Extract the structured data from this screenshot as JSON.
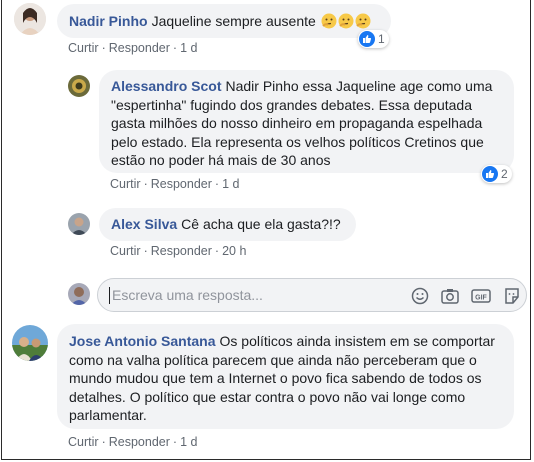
{
  "comments": [
    {
      "author": "Nadir Pinho",
      "text": "Jaqueline sempre ausente",
      "emojis": [
        "thinking-face",
        "thinking-face",
        "thinking-face"
      ],
      "actions": {
        "like": "Curtir",
        "reply": "Responder",
        "time": "1 d"
      },
      "reaction_count": "1"
    },
    {
      "author": "Alessandro Scot",
      "text": "Nadir Pinho essa Jaqueline age como uma \"espertinha\" fugindo dos grandes debates. Essa deputada gasta milhões do nosso dinheiro em propaganda espelhada pelo estado. Ela representa os velhos políticos Cretinos que estão no poder há mais de 30 anos",
      "actions": {
        "like": "Curtir",
        "reply": "Responder",
        "time": "1 d"
      },
      "reaction_count": "2"
    },
    {
      "author": "Alex Silva",
      "text": "Cê acha que ela gasta?!?",
      "actions": {
        "like": "Curtir",
        "reply": "Responder",
        "time": "20 h"
      }
    },
    {
      "author": "Jose Antonio Santana",
      "text": "Os políticos ainda insistem em se comportar como na valha política parecem que ainda não perceberam que o mundo mudou que tem a Internet o povo fica sabendo de todos os detalhes. O político que estar contra o povo não vai longe como parlamentar.",
      "actions": {
        "like": "Curtir",
        "reply": "Responder",
        "time": "1 d"
      }
    }
  ],
  "reply_box": {
    "placeholder": "Escreva uma resposta...",
    "icons": [
      "emoji-icon",
      "camera-icon",
      "gif-icon",
      "sticker-icon"
    ]
  },
  "colors": {
    "author": "#385898",
    "bubble": "#f2f3f5",
    "like_blue": "#1877f2",
    "meta": "#606770"
  }
}
